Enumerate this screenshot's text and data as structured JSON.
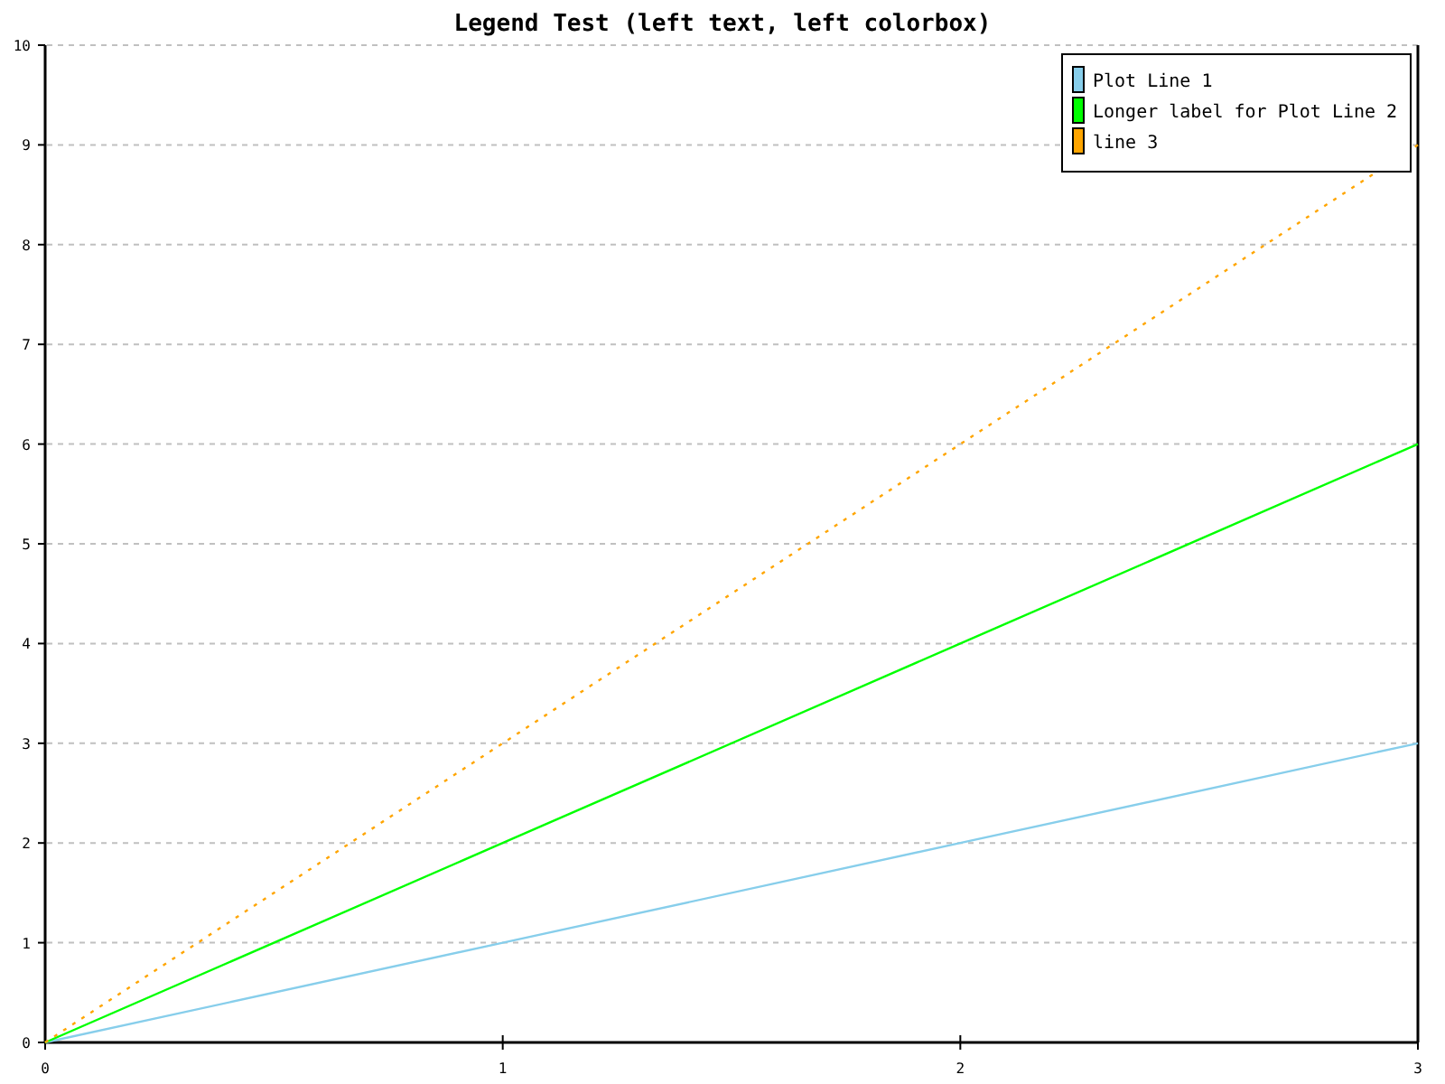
{
  "chart_data": {
    "type": "line",
    "title": "Legend Test (left text, left colorbox)",
    "x": [
      0,
      1,
      2,
      3
    ],
    "xlim": [
      0,
      3
    ],
    "ylim": [
      0,
      10
    ],
    "xticks": [
      0,
      1,
      2,
      3
    ],
    "yticks": [
      0,
      1,
      2,
      3,
      4,
      5,
      6,
      7,
      8,
      9,
      10
    ],
    "grid": true,
    "legend": true,
    "series": [
      {
        "name": "Plot Line 1",
        "color": "#87ceeb",
        "line_style": "solid",
        "values": [
          0,
          1,
          2,
          3
        ]
      },
      {
        "name": "Longer label for Plot Line 2",
        "color": "#00ff00",
        "line_style": "solid",
        "values": [
          0,
          2,
          4,
          6
        ]
      },
      {
        "name": "line 3",
        "color": "#ffa500",
        "line_style": "dotted",
        "values": [
          0,
          3,
          6,
          9
        ]
      }
    ]
  }
}
